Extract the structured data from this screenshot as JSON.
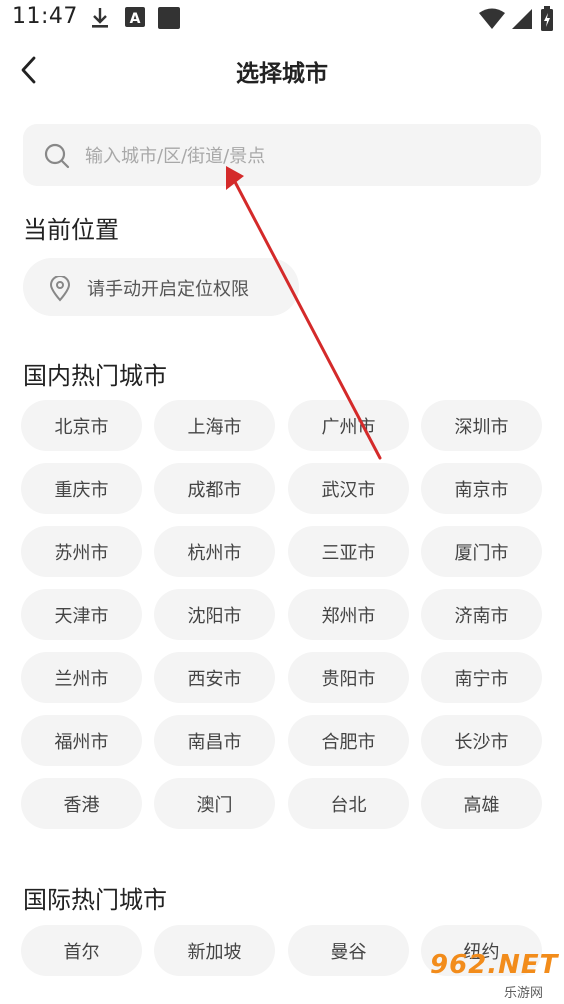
{
  "status_bar": {
    "time": "11:47",
    "icons": [
      "download-icon",
      "a-icon",
      "square-icon",
      "wifi-icon",
      "signal-icon",
      "battery-icon"
    ]
  },
  "header": {
    "back_icon": "chevron-left-icon",
    "title": "选择城市"
  },
  "search": {
    "placeholder": "输入城市/区/街道/景点",
    "icon": "search-icon"
  },
  "current_location": {
    "title": "当前位置",
    "button_text": "请手动开启定位权限",
    "icon": "location-pin-icon"
  },
  "domestic_hot": {
    "title": "国内热门城市",
    "cities": [
      "北京市",
      "上海市",
      "广州市",
      "深圳市",
      "重庆市",
      "成都市",
      "武汉市",
      "南京市",
      "苏州市",
      "杭州市",
      "三亚市",
      "厦门市",
      "天津市",
      "沈阳市",
      "郑州市",
      "济南市",
      "兰州市",
      "西安市",
      "贵阳市",
      "南宁市",
      "福州市",
      "南昌市",
      "合肥市",
      "长沙市",
      "香港",
      "澳门",
      "台北",
      "高雄"
    ]
  },
  "international_hot": {
    "title": "国际热门城市",
    "cities": [
      "首尔",
      "新加坡",
      "曼谷",
      "纽约"
    ]
  },
  "annotation": {
    "color": "#d42a2a"
  },
  "watermark": {
    "brand": "962.NET",
    "sub": "乐游网"
  },
  "colors": {
    "chip_bg": "#f4f4f4",
    "text_primary": "#222222",
    "placeholder": "#a8a8a8"
  }
}
